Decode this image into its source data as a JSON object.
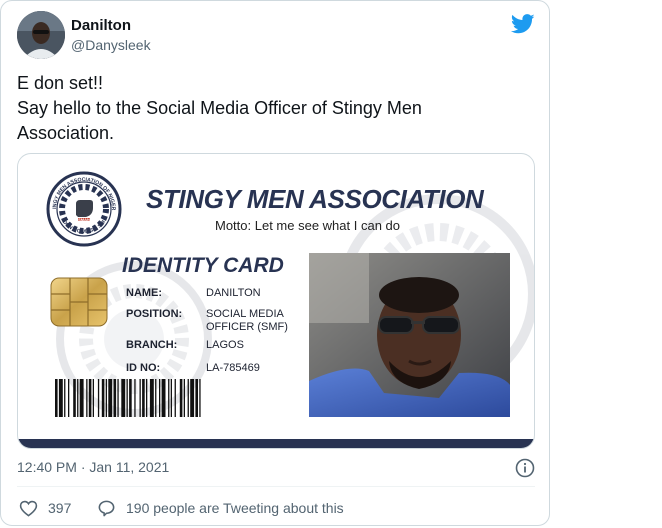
{
  "author": {
    "name": "Danilton",
    "handle": "@Danysleek",
    "avatar_icon": "profile-photo"
  },
  "tweet": {
    "lines": [
      "E don set!!",
      "Say hello to the Social Media Officer of Stingy Men",
      "Association."
    ]
  },
  "id_card": {
    "title": "STINGY MEN ASSOCIATION",
    "motto": "Motto: Let me see what I can do",
    "card_label": "IDENTITY CARD",
    "fields": [
      {
        "label": "NAME:",
        "value": "DANILTON"
      },
      {
        "label": "POSITION:",
        "value": "SOCIAL MEDIA"
      },
      {
        "label": "",
        "value": "OFFICER (SMF)"
      },
      {
        "label": "BRANCH:",
        "value": "LAGOS"
      },
      {
        "label": "ID NO:",
        "value": "LA-785469"
      }
    ],
    "seal_top_text": "STINGY MEN ASSOCIATION OF NIGERIA",
    "seal_bottom_text": "DON'T GIVE SHI SHI",
    "seal_center_text": "SMAN",
    "accent_color": "#283352"
  },
  "meta": {
    "timestamp": "12:40 PM · Jan 11, 2021",
    "likes": "397",
    "conversation": "190 people are Tweeting about this"
  },
  "colors": {
    "twitter_blue": "#1d9bf0",
    "secondary_text": "#536471",
    "border": "#cfd9de"
  }
}
